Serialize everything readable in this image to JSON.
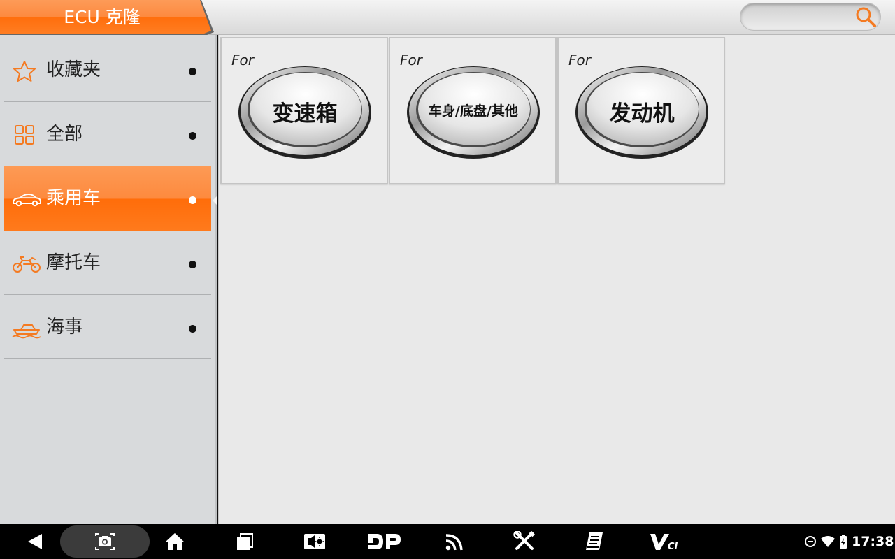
{
  "header": {
    "title": "ECU 克隆",
    "search": {
      "value": "",
      "placeholder": ""
    }
  },
  "sidebar": {
    "items": [
      {
        "label": "收藏夹",
        "icon": "star-icon",
        "active": false
      },
      {
        "label": "全部",
        "icon": "grid-icon",
        "active": false
      },
      {
        "label": "乘用车",
        "icon": "car-icon",
        "active": true
      },
      {
        "label": "摩托车",
        "icon": "motorcycle-icon",
        "active": false
      },
      {
        "label": "海事",
        "icon": "boat-icon",
        "active": false
      }
    ]
  },
  "tiles": [
    {
      "prefix": "For",
      "label": "变速箱"
    },
    {
      "prefix": "For",
      "label": "车身/底盘/其他"
    },
    {
      "prefix": "For",
      "label": "发动机"
    }
  ],
  "navbar": {
    "buttons": [
      "back-icon",
      "screenshot-icon",
      "home-icon",
      "recent-apps-icon",
      "brightness-icon",
      "dp-icon",
      "wireless-icon",
      "tools-icon",
      "notes-icon",
      "vci-icon"
    ],
    "status": {
      "time": "17:38",
      "icons": [
        "do-not-disturb-icon",
        "wifi-icon",
        "battery-icon"
      ]
    }
  },
  "colors": {
    "accent": "#ff7a1c",
    "accent_light": "#fd9a55",
    "icon_orange": "#f47a21"
  }
}
